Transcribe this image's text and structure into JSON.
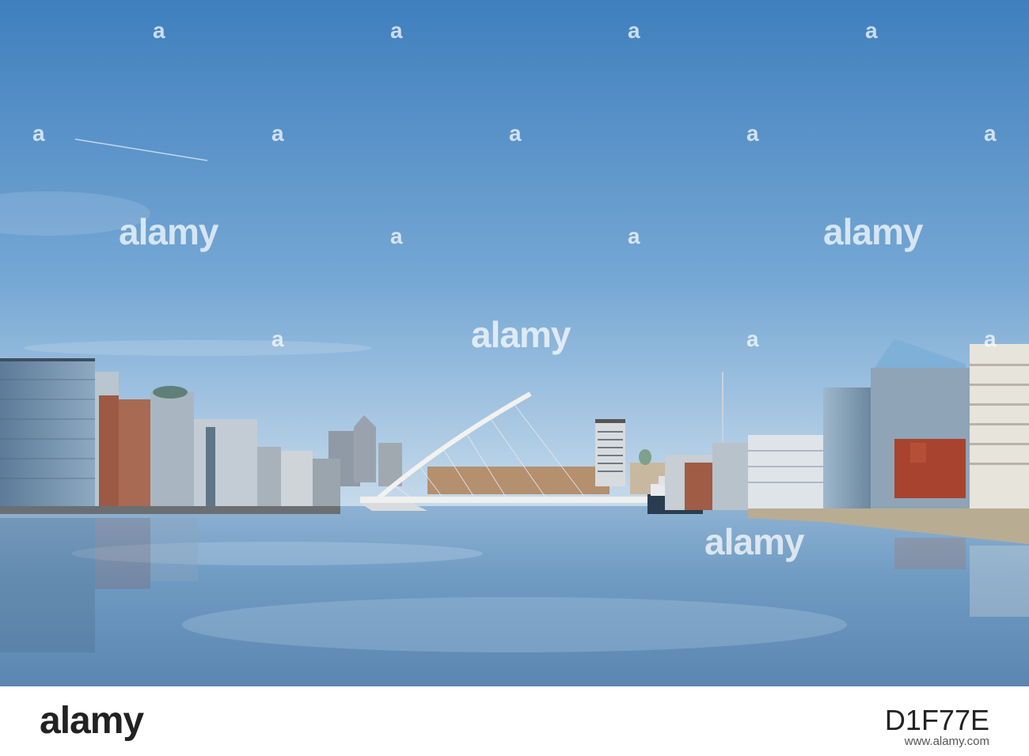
{
  "photo": {
    "watermark_text": "alamy",
    "watermark_mark": "a",
    "colors": {
      "sky_top": "#3f7fbe",
      "sky_mid": "#76a8d4",
      "sky_horizon": "#c9dcec",
      "water_top": "#7fa6c9",
      "water_bottom": "#5d89b3",
      "buildings_glass": "#6d8aa6",
      "buildings_brick": "#9c5a45",
      "bridge": "#f2f2f0"
    }
  },
  "footer": {
    "logo": "alamy",
    "image_id": "D1F77E",
    "domain": "www.alamy.com"
  }
}
